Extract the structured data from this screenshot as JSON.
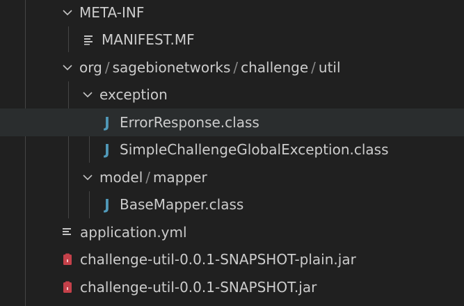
{
  "tree": {
    "meta_inf": {
      "label": "META-INF",
      "icon": "chevron-down-icon"
    },
    "manifest": {
      "label": "MANIFEST.MF",
      "icon": "lines-file-icon"
    },
    "package": {
      "segments": [
        "org",
        "sagebionetworks",
        "challenge",
        "util"
      ],
      "separator": "/",
      "icon": "chevron-down-icon"
    },
    "exception": {
      "label": "exception",
      "icon": "chevron-down-icon"
    },
    "error_response": {
      "label": "ErrorResponse.class",
      "icon": "java-class-icon",
      "glyph": "J"
    },
    "simple_exception": {
      "label": "SimpleChallengeGlobalException.class",
      "icon": "java-class-icon",
      "glyph": "J"
    },
    "model_mapper": {
      "segments": [
        "model",
        "mapper"
      ],
      "separator": "/",
      "icon": "chevron-down-icon"
    },
    "base_mapper": {
      "label": "BaseMapper.class",
      "icon": "java-class-icon",
      "glyph": "J"
    },
    "application_yml": {
      "label": "application.yml",
      "icon": "lines-file-icon"
    },
    "plain_jar": {
      "label": "challenge-util-0.0.1-SNAPSHOT-plain.jar",
      "icon": "jar-file-icon"
    },
    "jar": {
      "label": "challenge-util-0.0.1-SNAPSHOT.jar",
      "icon": "jar-file-icon"
    }
  },
  "colors": {
    "background": "#202020",
    "hover_row": "#2a2d2e",
    "text": "#cccccc",
    "java_icon": "#519aba",
    "jar_icon": "#c5414a",
    "indent_guide": "#454545"
  }
}
